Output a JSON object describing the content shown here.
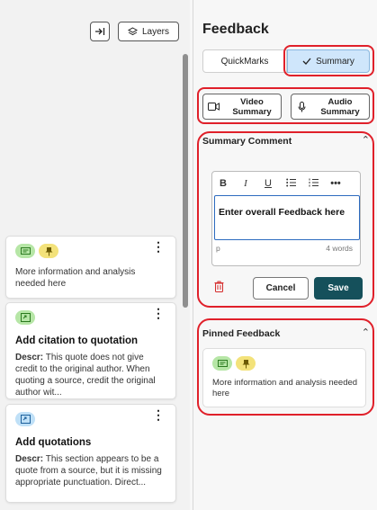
{
  "left_pane": {
    "collapse_icon": "arrow-to-right-icon",
    "layers_label": "Layers",
    "cards": [
      {
        "type": "pinned",
        "body": "More information and analysis needed here"
      },
      {
        "type": "quickmark",
        "title": "Add citation to quotation",
        "descr_label": "Descr:",
        "descr": "This quote does not give credit to the original author. When quoting a source, credit the original author wit..."
      },
      {
        "type": "quickmark",
        "title": "Add quotations",
        "descr_label": "Descr:",
        "descr": "This section appears to be a quote from a source, but it is missing appropriate punctuation. Direct..."
      }
    ]
  },
  "right_pane": {
    "title": "Feedback",
    "tabs": {
      "quickmarks": "QuickMarks",
      "summary": "Summary"
    },
    "video_summary": "Video Summary",
    "audio_summary": "Audio Summary",
    "summary_comment": {
      "heading": "Summary Comment",
      "toolbar": [
        "B",
        "I",
        "U",
        "bullet-list",
        "numbered-list",
        "more"
      ],
      "text": "Enter overall Feedback here",
      "path_label": "p",
      "word_count": "4 words",
      "cancel": "Cancel",
      "save": "Save"
    },
    "pinned": {
      "heading": "Pinned Feedback",
      "body": "More information and analysis needed here"
    }
  },
  "colors": {
    "accent": "#15505b",
    "highlight": "#e0202a",
    "selected_tab": "#cfe6fb"
  }
}
